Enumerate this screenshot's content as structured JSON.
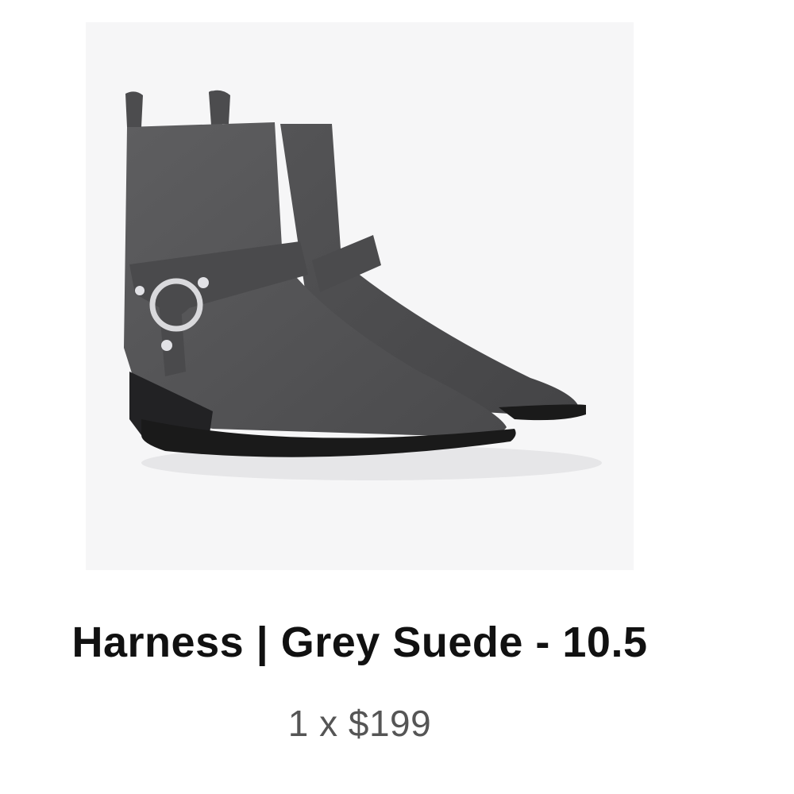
{
  "product": {
    "image_icon": "boot-product-image",
    "title": "Harness | Grey Suede - 10.5",
    "qty_price": "1 x $199"
  },
  "colors": {
    "image_background": "#f6f6f7",
    "title_text": "#111111",
    "price_text": "#555555",
    "suede": "#58585a",
    "sole": "#1a1a1a",
    "hardware": "#d9d9dc"
  }
}
